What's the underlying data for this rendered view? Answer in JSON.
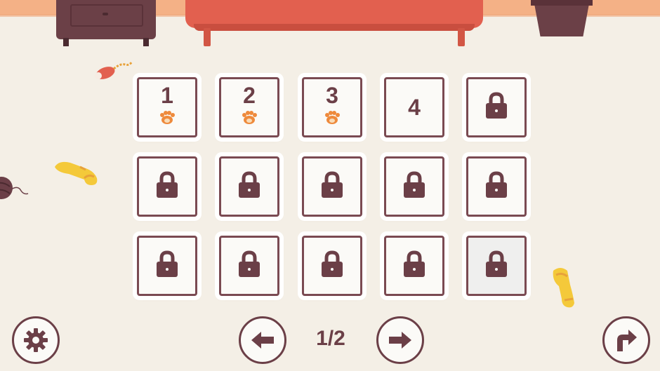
{
  "levels": [
    {
      "label": "1",
      "state": "completed",
      "icon": "paw-icon"
    },
    {
      "label": "2",
      "state": "completed",
      "icon": "paw-icon"
    },
    {
      "label": "3",
      "state": "completed",
      "icon": "paw-icon"
    },
    {
      "label": "4",
      "state": "unlocked",
      "icon": ""
    },
    {
      "label": "",
      "state": "locked",
      "icon": "lock-icon"
    },
    {
      "label": "",
      "state": "locked",
      "icon": "lock-icon"
    },
    {
      "label": "",
      "state": "locked",
      "icon": "lock-icon"
    },
    {
      "label": "",
      "state": "locked",
      "icon": "lock-icon"
    },
    {
      "label": "",
      "state": "locked",
      "icon": "lock-icon"
    },
    {
      "label": "",
      "state": "locked",
      "icon": "lock-icon"
    },
    {
      "label": "",
      "state": "locked",
      "icon": "lock-icon"
    },
    {
      "label": "",
      "state": "locked",
      "icon": "lock-icon"
    },
    {
      "label": "",
      "state": "locked",
      "icon": "lock-icon"
    },
    {
      "label": "",
      "state": "locked",
      "icon": "lock-icon"
    },
    {
      "label": "",
      "state": "locked",
      "icon": "lock-icon",
      "selected": true
    }
  ],
  "pagination": {
    "indicator": "1/2"
  },
  "controls": {
    "settings_icon": "gear-icon",
    "prev_icon": "arrow-left-icon",
    "next_icon": "arrow-right-icon",
    "back_icon": "turn-arrow-icon"
  },
  "colors": {
    "background": "#f4efe6",
    "wall": "#f4b186",
    "tile_border": "#7a4a52",
    "text": "#6b3f47",
    "paw": "#ee8a3c",
    "sofa": "#e2604f"
  }
}
